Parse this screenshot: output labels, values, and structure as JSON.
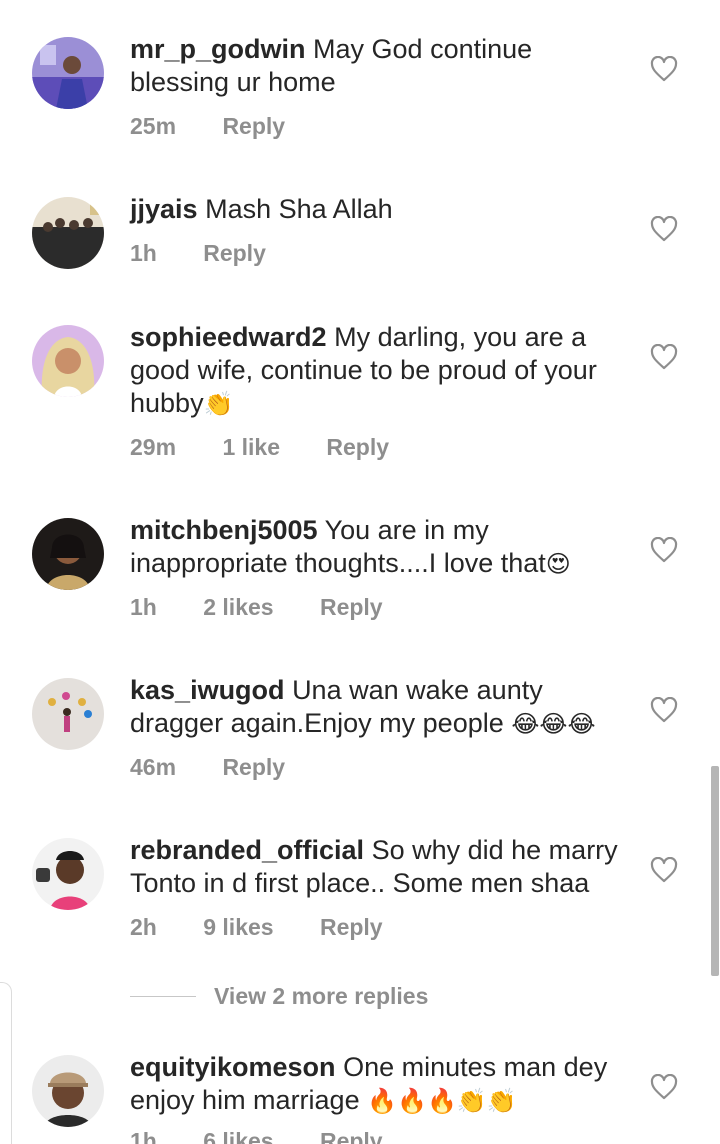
{
  "comments": [
    {
      "username": "mr_p_godwin",
      "text": "May God continue blessing ur home",
      "emoji": "",
      "time": "25m",
      "likes": "",
      "reply": "Reply",
      "avatar_icon": "user-avatar"
    },
    {
      "username": "jjyais",
      "text": "Mash Sha Allah",
      "emoji": "",
      "time": "1h",
      "likes": "",
      "reply": "Reply",
      "avatar_icon": "user-avatar"
    },
    {
      "username": "sophieedward2",
      "text": "My darling, you are a good wife, continue to be proud of your hubby",
      "emoji": "👏",
      "time": "29m",
      "likes": "1 like",
      "reply": "Reply",
      "avatar_icon": "user-avatar"
    },
    {
      "username": "mitchbenj5005",
      "text": "You are in my inappropriate thoughts....I love that",
      "emoji": "😍",
      "time": "1h",
      "likes": "2 likes",
      "reply": "Reply",
      "avatar_icon": "user-avatar"
    },
    {
      "username": "kas_iwugod",
      "text": "Una wan wake aunty dragger again.Enjoy my people",
      "emoji": " 😂😂😂",
      "time": "46m",
      "likes": "",
      "reply": "Reply",
      "avatar_icon": "user-avatar"
    },
    {
      "username": "rebranded_official",
      "text": "So why did he marry Tonto in d first place.. Some men shaa",
      "emoji": "",
      "time": "2h",
      "likes": "9 likes",
      "reply": "Reply",
      "avatar_icon": "user-avatar"
    },
    {
      "username": "equityikomeson",
      "text": "One minutes man dey enjoy him marriage",
      "emoji": " 🔥🔥🔥👏👏",
      "time": "1h",
      "likes": "6 likes",
      "reply": "Reply",
      "avatar_icon": "user-avatar"
    }
  ],
  "more_replies": {
    "label": "View 2 more replies"
  },
  "colors": {
    "text": "#262626",
    "meta": "#8e8e8e",
    "divider": "#c7c7c7"
  }
}
